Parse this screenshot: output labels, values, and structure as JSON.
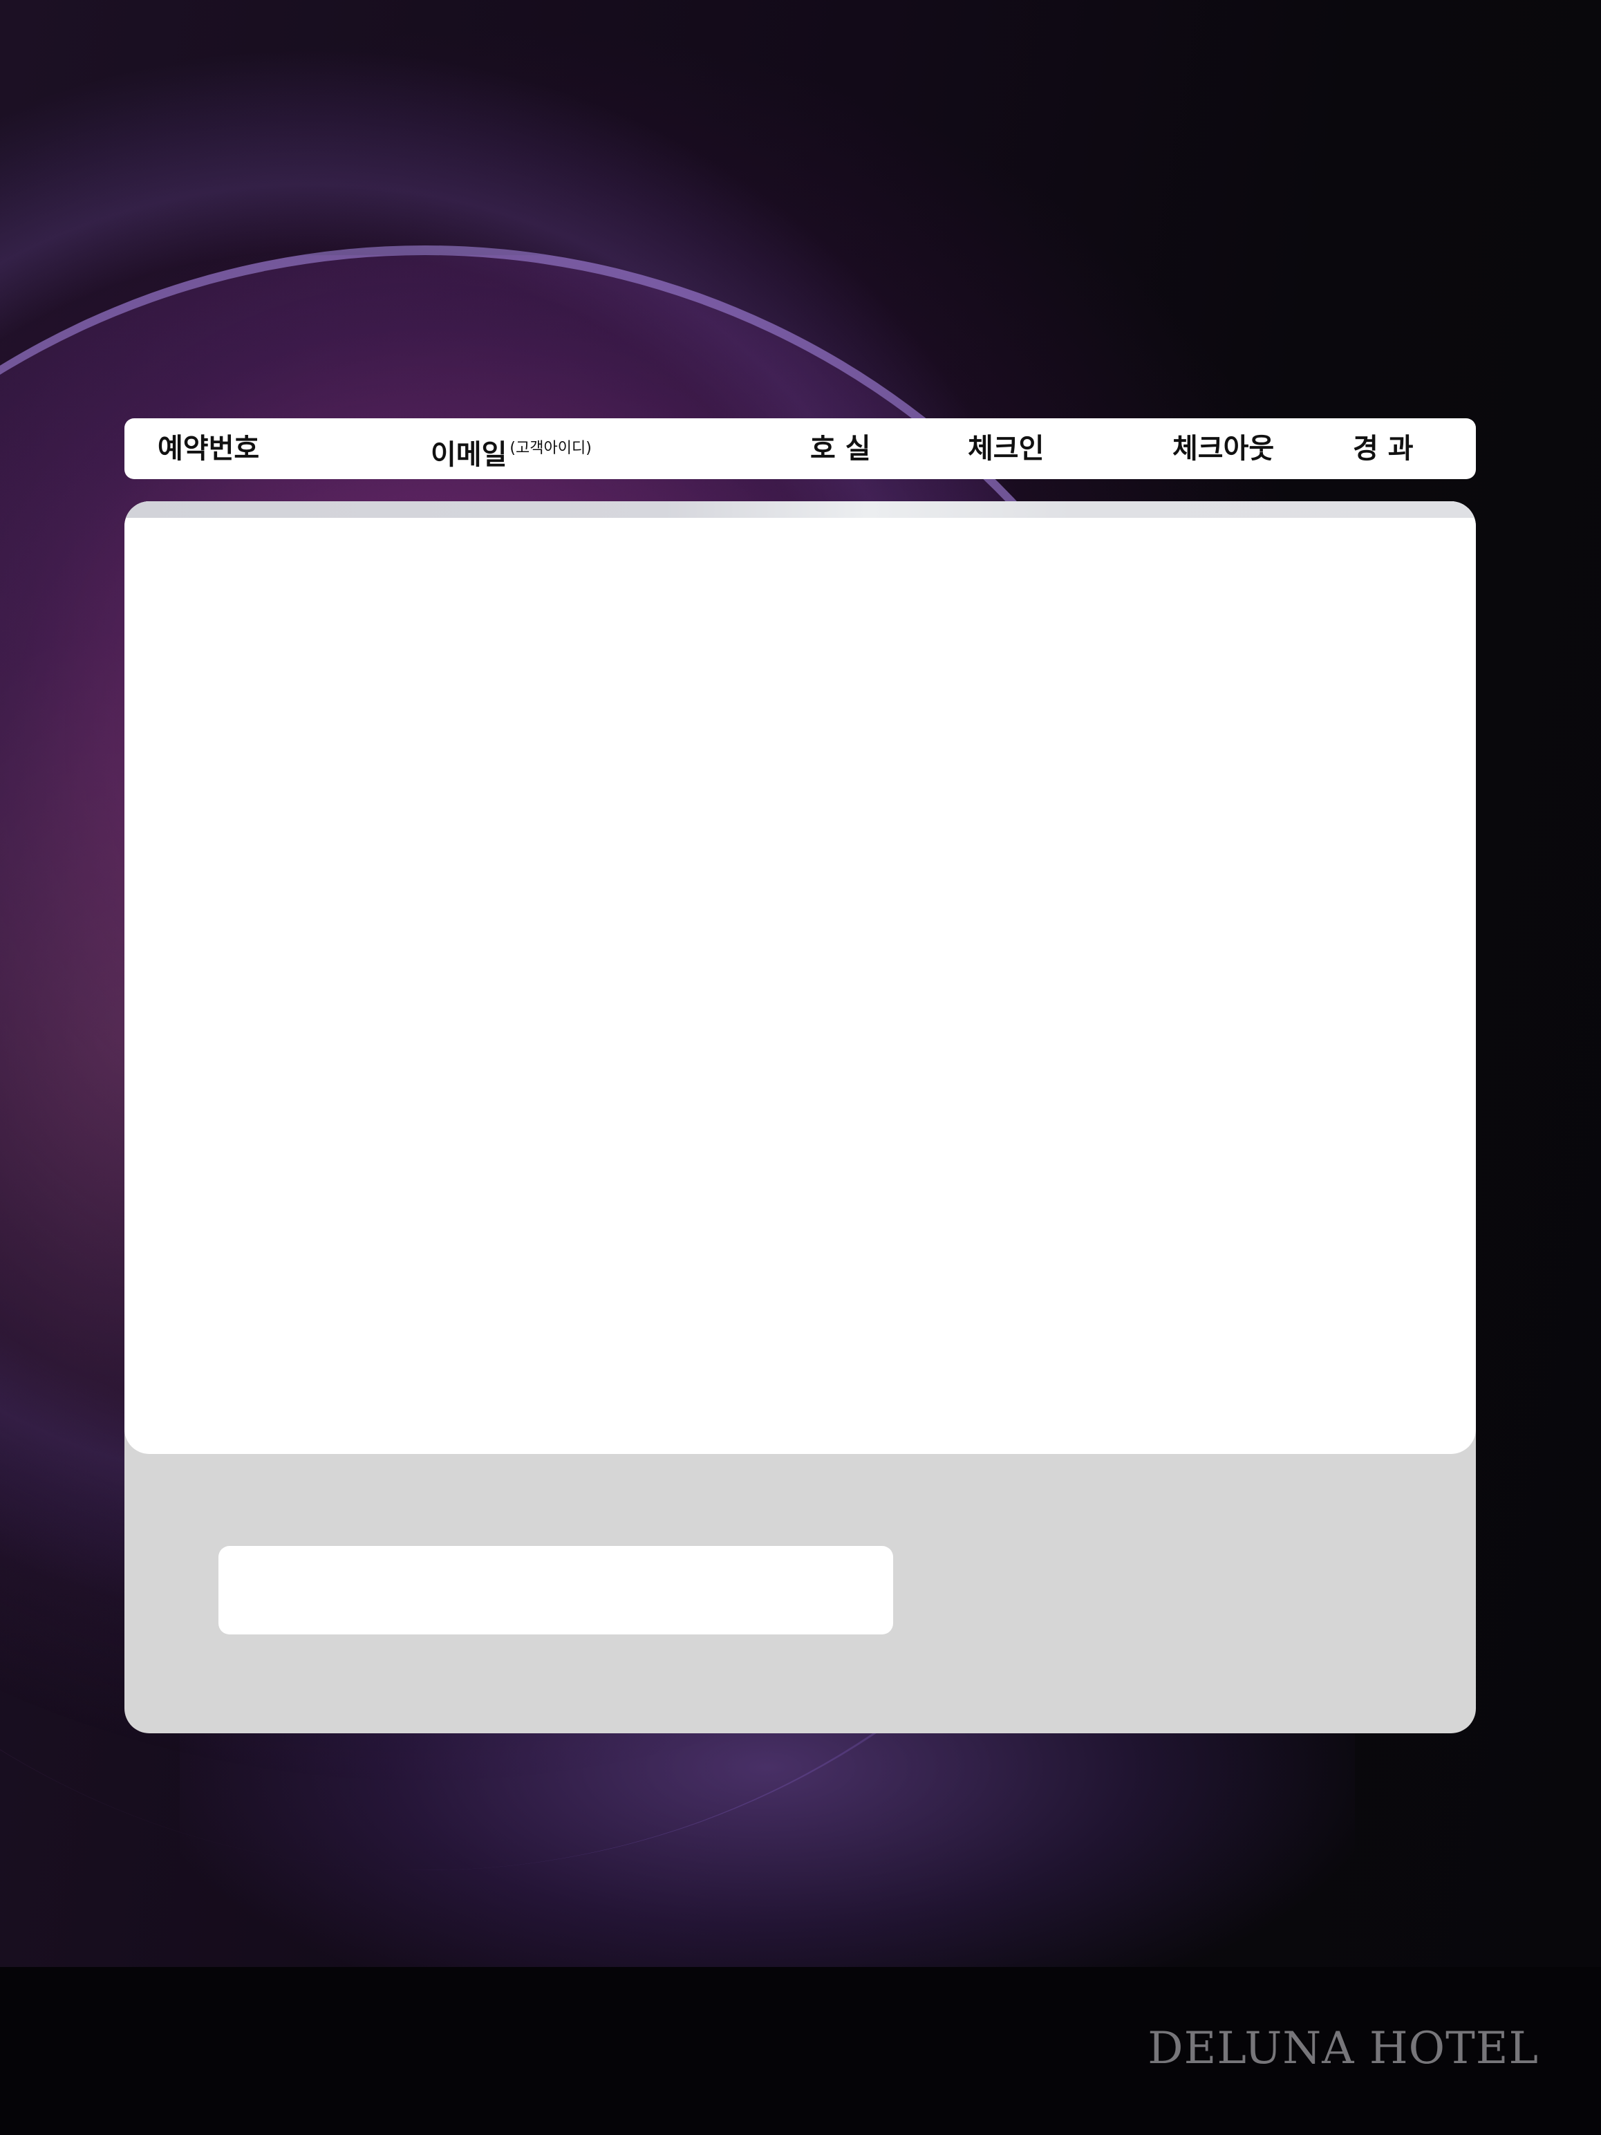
{
  "table_header": {
    "reservation_no": "예약번호",
    "email": "이메일",
    "email_note": "(고객아이디)",
    "room": "호 실",
    "checkin": "체크인",
    "checkout": "체크아웃",
    "result": "경 과"
  },
  "reservation_list": {
    "rows": []
  },
  "search": {
    "value": "",
    "placeholder": ""
  },
  "footer": {
    "brand": "DELUNA HOTEL"
  },
  "colors": {
    "panel_bg": "#d6d6d6",
    "header_bg": "#ffffff",
    "bottom_bar": "#050407",
    "brand_text": "#77767a"
  }
}
